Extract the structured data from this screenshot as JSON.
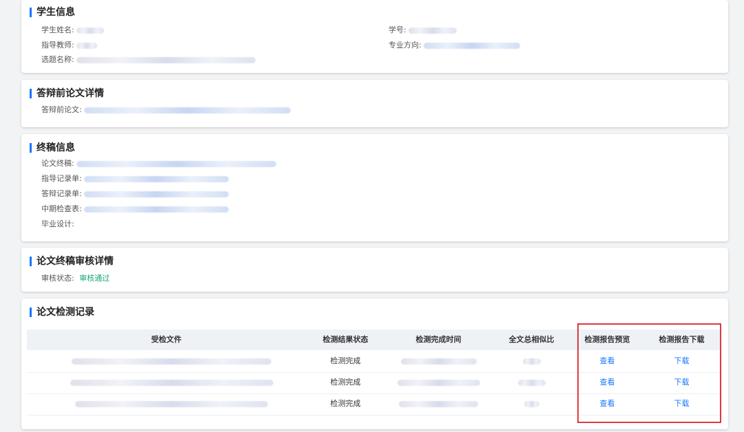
{
  "student_info": {
    "title": "学生信息",
    "name_label": "学生姓名:",
    "id_label": "学号:",
    "teacher_label": "指导教师:",
    "major_label": "专业方向:",
    "topic_label": "选题名称:"
  },
  "pre_defense": {
    "title": "答辩前论文详情",
    "paper_label": "答辩前论文:"
  },
  "final_info": {
    "title": "终稿信息",
    "items": [
      {
        "label": "论文终稿:"
      },
      {
        "label": "指导记录单:"
      },
      {
        "label": "答辩记录单:"
      },
      {
        "label": "中期检查表:"
      },
      {
        "label": "毕业设计:"
      }
    ]
  },
  "review": {
    "title": "论文终稿审核详情",
    "status_label": "审核状态:",
    "status_value": "审核通过"
  },
  "check_records": {
    "title": "论文检测记录",
    "columns": {
      "file": "受检文件",
      "status": "检测结果状态",
      "time": "检测完成时间",
      "similarity": "全文总相似比",
      "preview": "检测报告预览",
      "download": "检测报告下载"
    },
    "rows": [
      {
        "status": "检测完成",
        "preview": "查看",
        "download": "下载"
      },
      {
        "status": "检测完成",
        "preview": "查看",
        "download": "下载"
      },
      {
        "status": "检测完成",
        "preview": "查看",
        "download": "下载"
      }
    ]
  },
  "colors": {
    "accent": "#1677ff",
    "success": "#19a974",
    "highlight": "#e0383e"
  }
}
